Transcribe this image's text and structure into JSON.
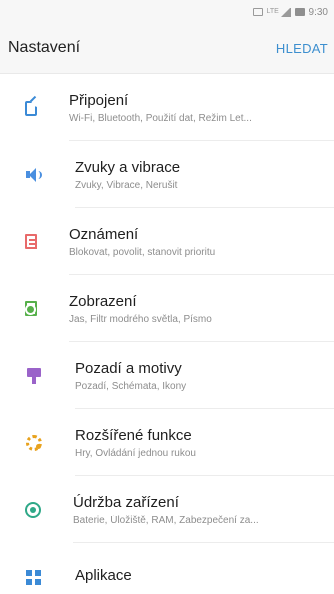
{
  "status_bar": {
    "icons": [
      "nfc-icon",
      "lte-icon",
      "signal-icon",
      "battery-icon"
    ],
    "lte_label": "LTE",
    "time": "9:30"
  },
  "header": {
    "title": "Nastavení",
    "search_label": "HLEDAT"
  },
  "colors": {
    "accent": "#3d8fcf",
    "background": "#f7f7f7",
    "list_background": "#ffffff"
  },
  "items": [
    {
      "icon": "connections-icon",
      "title": "Připojení",
      "subtitle": "Wi-Fi, Bluetooth, Použití dat, Režim Let..."
    },
    {
      "icon": "sound-icon",
      "title": "Zvuky a vibrace",
      "subtitle": "Zvuky, Vibrace, Nerušit"
    },
    {
      "icon": "notifications-icon",
      "title": "Oznámení",
      "subtitle": "Blokovat, povolit, stanovit prioritu"
    },
    {
      "icon": "display-icon",
      "title": "Zobrazení",
      "subtitle": "Jas, Filtr modrého světla, Písmo"
    },
    {
      "icon": "wallpaper-icon",
      "title": "Pozadí a motivy",
      "subtitle": "Pozadí, Schémata, Ikony"
    },
    {
      "icon": "advanced-features-icon",
      "title": "Rozšířené funkce",
      "subtitle": "Hry, Ovládání jednou rukou"
    },
    {
      "icon": "device-maintenance-icon",
      "title": "Údržba zařízení",
      "subtitle": "Baterie, Úložiště, RAM, Zabezpečení za..."
    },
    {
      "icon": "apps-icon",
      "title": "Aplikace",
      "subtitle": ""
    }
  ]
}
